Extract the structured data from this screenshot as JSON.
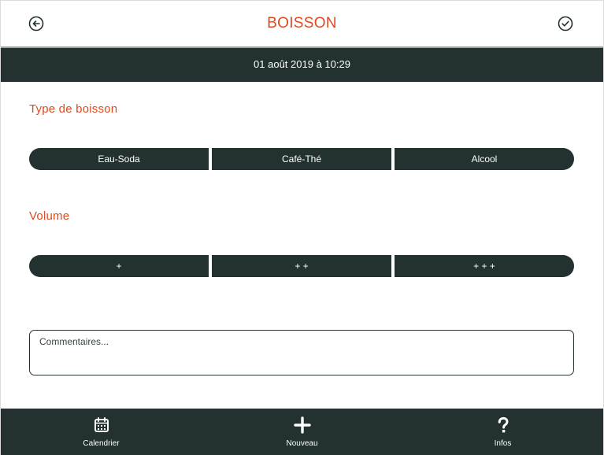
{
  "header": {
    "title": "BOISSON",
    "back_icon": "arrow-left-circle-icon",
    "confirm_icon": "check-circle-icon"
  },
  "date_bar": {
    "text": "01 août 2019 à 10:29"
  },
  "drink_type": {
    "label": "Type de boisson",
    "options": [
      "Eau-Soda",
      "Café-Thé",
      "Alcool"
    ]
  },
  "volume": {
    "label": "Volume",
    "options": [
      "+",
      "+ +",
      "+ + +"
    ]
  },
  "comment": {
    "value": "",
    "placeholder": "Commentaires..."
  },
  "tabbar": {
    "items": [
      {
        "label": "Calendrier",
        "icon": "calendar-icon"
      },
      {
        "label": "Nouveau",
        "icon": "plus-icon"
      },
      {
        "label": "Infos",
        "icon": "question-mark-icon"
      }
    ]
  },
  "colors": {
    "accent": "#e0491f",
    "dark": "#233230",
    "background": "#ffffff"
  }
}
